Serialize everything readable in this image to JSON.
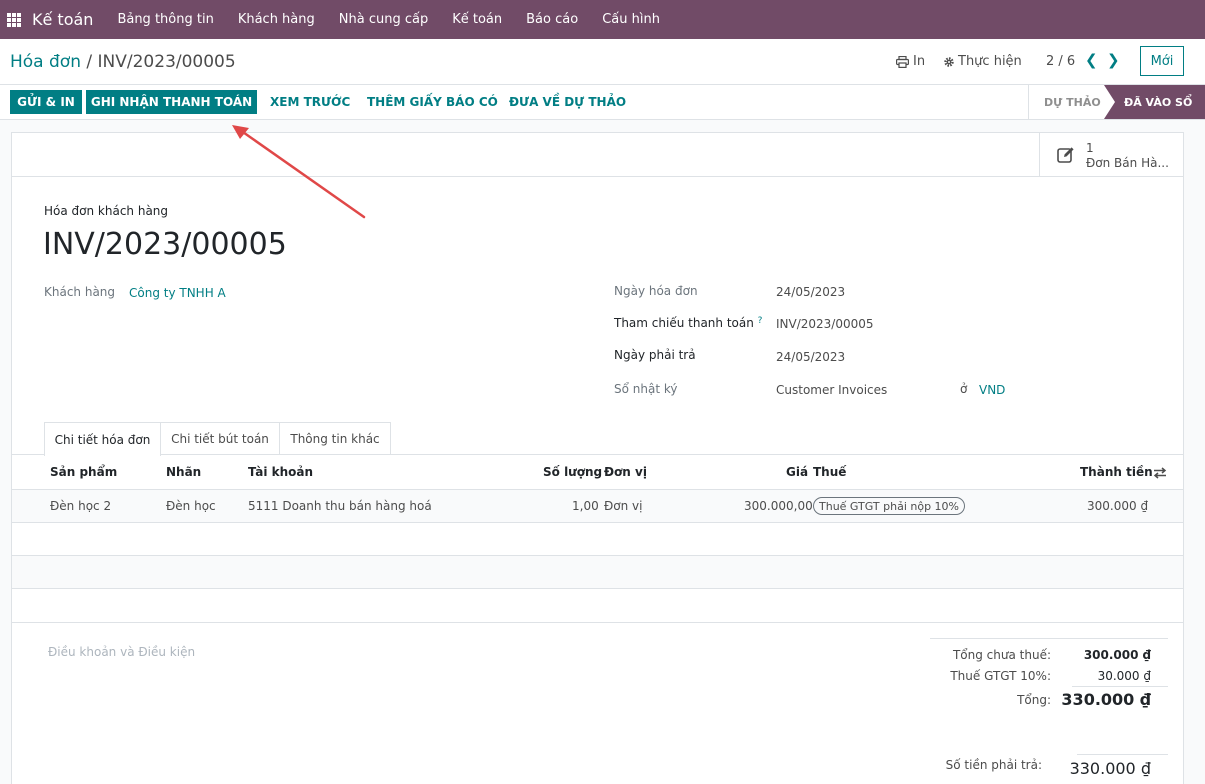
{
  "topbar": {
    "app_name": "Kế toán",
    "menu": [
      "Bảng thông tin",
      "Khách hàng",
      "Nhà cung cấp",
      "Kế toán",
      "Báo cáo",
      "Cấu hình"
    ]
  },
  "control": {
    "breadcrumb_parent": "Hóa đơn",
    "breadcrumb_sep": "/",
    "breadcrumb_current": "INV/2023/00005",
    "print_label": "In",
    "action_label": "Thực hiện",
    "pager": "2 / 6",
    "new_label": "Mới"
  },
  "status": {
    "send_print": "GỬI & IN",
    "register_payment": "GHI NHẬN THANH TOÁN",
    "preview": "XEM TRƯỚC",
    "credit_note": "THÊM GIẤY BÁO CÓ",
    "reset_draft": "ĐƯA VỀ DỰ THẢO",
    "stage_draft": "DỰ THẢO",
    "stage_posted": "ĐÃ VÀO SỔ"
  },
  "smart_button": {
    "count": "1",
    "label": "Đơn Bán Hà..."
  },
  "form": {
    "doc_type": "Hóa đơn khách hàng",
    "doc_name": "INV/2023/00005",
    "customer_label": "Khách hàng",
    "customer_value": "Công ty TNHH A",
    "invoice_date_label": "Ngày hóa đơn",
    "invoice_date_value": "24/05/2023",
    "payment_ref_label": "Tham chiếu thanh toán",
    "payment_ref_help": "?",
    "payment_ref_value": "INV/2023/00005",
    "due_date_label": "Ngày phải trả",
    "due_date_value": "24/05/2023",
    "journal_label": "Sổ nhật ký",
    "journal_value": "Customer Invoices",
    "currency_in": "ở",
    "currency_value": "VND"
  },
  "tabs": [
    "Chi tiết hóa đơn",
    "Chi tiết bút toán",
    "Thông tin khác"
  ],
  "table": {
    "headers": [
      "Sản phẩm",
      "Nhãn",
      "Tài khoản",
      "Số lượng",
      "Đơn vị",
      "Giá",
      "Thuế",
      "Thành tiền"
    ],
    "rows": [
      [
        "Đèn học 2",
        "Đèn học",
        "5111 Doanh thu bán hàng hoá",
        "1,00",
        "Đơn vị",
        "300.000,00",
        "Thuế GTGT phải nộp 10%",
        "300.000 ₫"
      ]
    ]
  },
  "footer": {
    "terms_placeholder": "Điều khoản và Điều kiện",
    "untaxed_label": "Tổng chưa thuế:",
    "untaxed_value": "300.000 ₫",
    "tax_label": "Thuế GTGT 10%:",
    "tax_value": "30.000 ₫",
    "total_label": "Tổng:",
    "total_value": "330.000 ₫",
    "due_label": "Số tiền phải trả:",
    "due_value": "330.000 ₫"
  },
  "colors": {
    "brand": "#714b67",
    "accent": "#017e84",
    "annotation": "#e04848"
  }
}
